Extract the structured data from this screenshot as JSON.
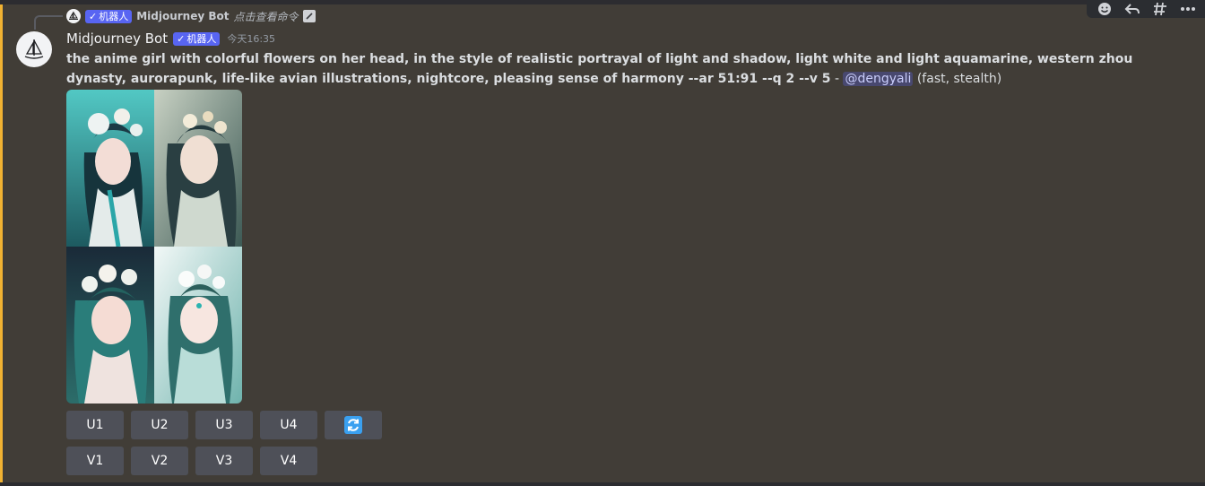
{
  "reply": {
    "bot_tag": "机器人",
    "author": "Midjourney Bot",
    "command_text": "点击查看命令"
  },
  "message": {
    "author": "Midjourney Bot",
    "bot_tag": "机器人",
    "timestamp": "今天16:35",
    "prompt": "the anime girl with colorful flowers on her head, in the style of realistic portrayal of light and shadow, light white and light aquamarine, western zhou dynasty, aurorapunk, life-like avian illustrations, nightcore, pleasing sense of harmony --ar 51:91 --q 2 --v 5",
    "separator": " - ",
    "mention": "@dengyali",
    "mode": "(fast, stealth)"
  },
  "image_grid": {
    "tiles": [
      {
        "name": "image-upper-left",
        "colors": [
          "#3fb6b3",
          "#1f3f4a",
          "#e9eef0"
        ]
      },
      {
        "name": "image-upper-right",
        "colors": [
          "#a8b7a8",
          "#2e4a4a",
          "#e7dccf"
        ]
      },
      {
        "name": "image-lower-left",
        "colors": [
          "#1b2e3a",
          "#2f8f8c",
          "#f3d7d0"
        ]
      },
      {
        "name": "image-lower-right",
        "colors": [
          "#e6f1f0",
          "#3a8f8a",
          "#f6e2dc"
        ]
      }
    ]
  },
  "buttons": {
    "upscale": [
      "U1",
      "U2",
      "U3",
      "U4"
    ],
    "variation": [
      "V1",
      "V2",
      "V3",
      "V4"
    ],
    "reroll_icon": "refresh-icon"
  },
  "colors": {
    "background": "#413d37",
    "mention_bar": "#f0b232",
    "bot_tag": "#5865f2",
    "button": "#4e5058",
    "reroll_icon": "#3aa0f0"
  }
}
